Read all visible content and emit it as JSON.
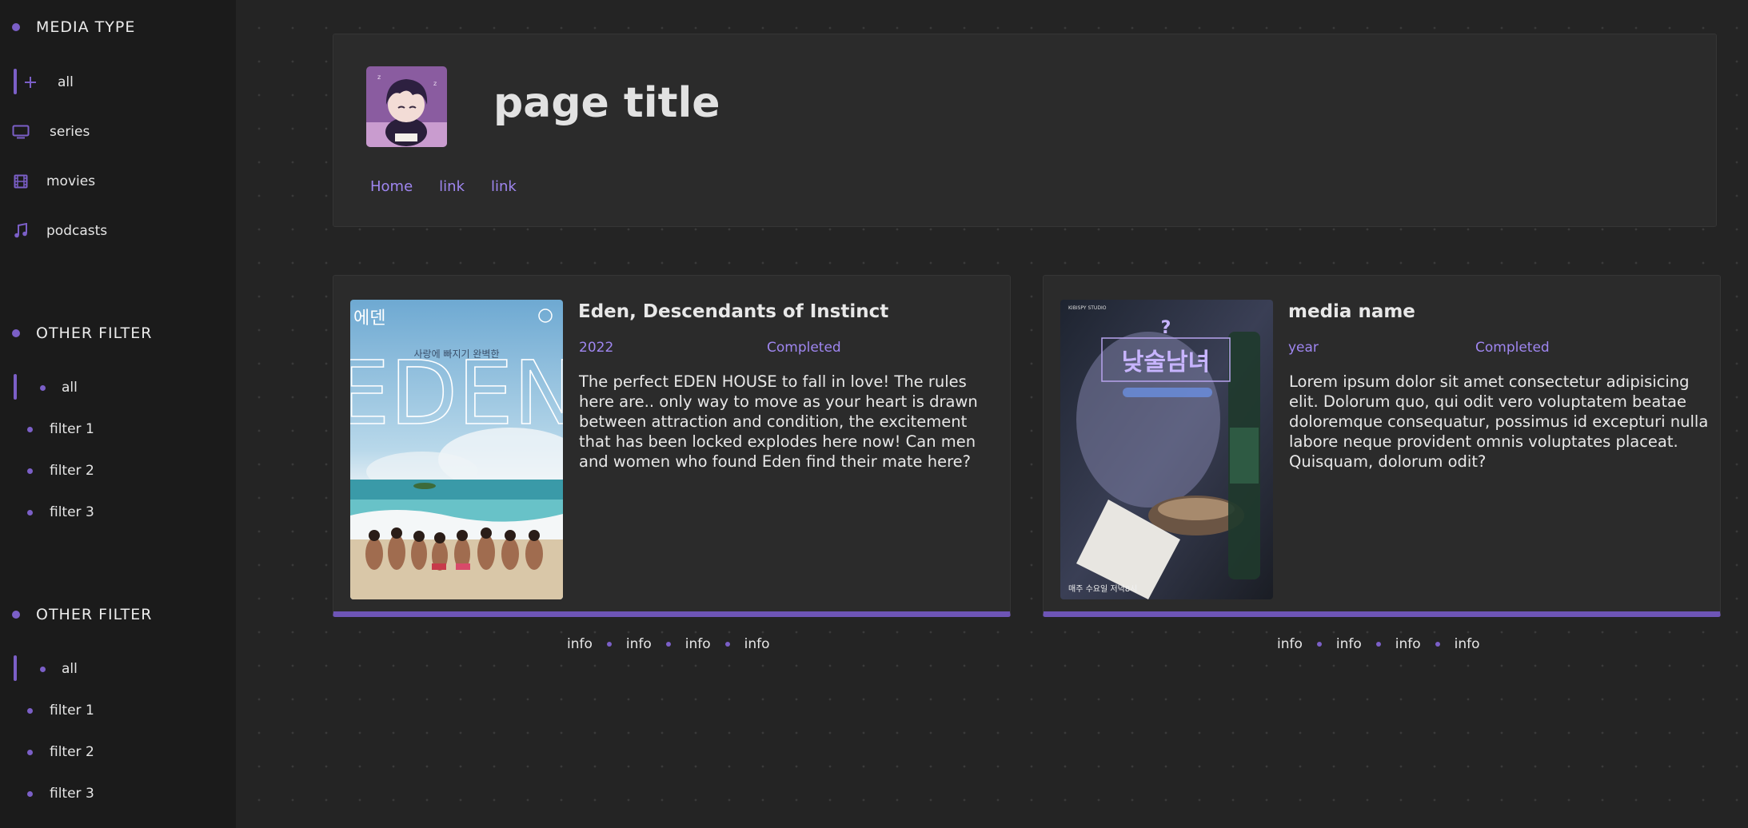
{
  "sidebar": {
    "media_type": {
      "heading": "MEDIA TYPE",
      "items": [
        {
          "label": "all",
          "icon": "plus-icon"
        },
        {
          "label": "series",
          "icon": "tv-icon"
        },
        {
          "label": "movies",
          "icon": "film-icon"
        },
        {
          "label": "podcasts",
          "icon": "music-icon"
        }
      ]
    },
    "filter_group_1": {
      "heading": "OTHER FILTER",
      "items": [
        "all",
        "filter 1",
        "filter 2",
        "filter 3"
      ]
    },
    "filter_group_2": {
      "heading": "OTHER FILTER",
      "items": [
        "all",
        "filter 1",
        "filter 2",
        "filter 3"
      ]
    }
  },
  "header": {
    "title": "page title",
    "links": [
      "Home",
      "link",
      "link"
    ]
  },
  "cards": [
    {
      "title": "Eden, Descendants of Instinct",
      "year": "2022",
      "status": "Completed",
      "description": "The perfect EDEN HOUSE to fall in love! The rules here are.. only way to move as your heart is drawn between attraction and condition, the excitement that has been locked explodes here now! Can men and women who found Eden find their mate here?",
      "poster": {
        "korean_title": "에덴",
        "tagline": "사랑에 빠지기 완벽한",
        "big_text": "EDEN"
      },
      "info": [
        "info",
        "info",
        "info",
        "info"
      ]
    },
    {
      "title": "media name",
      "year": "year",
      "status": "Completed",
      "description": "Lorem ipsum dolor sit amet consectetur adipisicing elit. Dolorum quo, qui odit vero voluptatem beatae doloremque consequatur, possimus id excepturi nulla labore neque provident omnis voluptates placeat. Quisquam, dolorum odit?",
      "poster": {
        "korean_title": "낮술남녀",
        "studio": "KIBISPY STUDIO",
        "bottom_text": "매주 수요일 저녁8시"
      },
      "info": [
        "info",
        "info",
        "info",
        "info"
      ]
    }
  ],
  "colors": {
    "accent": "#7b5fc7",
    "link": "#9f86f0",
    "sidebar_bg": "#1b1b1b",
    "page_bg": "#242424",
    "card_bg": "#2b2b2b"
  }
}
